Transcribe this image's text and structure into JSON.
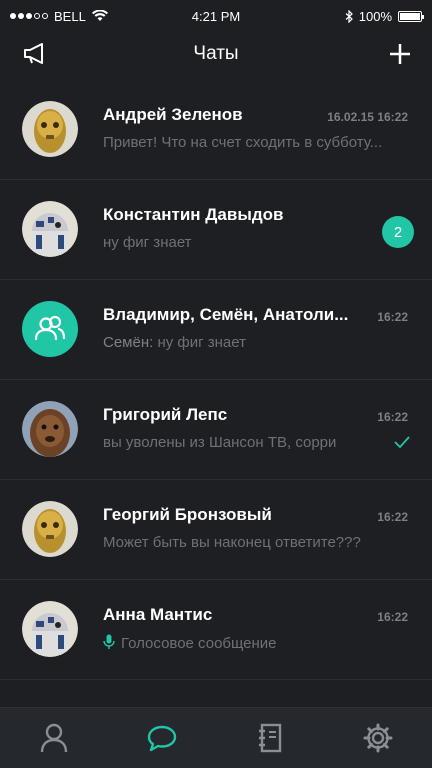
{
  "status_bar": {
    "carrier": "BELL",
    "time": "4:21 PM",
    "battery": "100%",
    "battery_level": 1.0,
    "signal_bars_filled": 3,
    "signal_bars_total": 5
  },
  "navbar": {
    "title": "Чаты",
    "left_icon": "megaphone-icon",
    "right_icon": "plus-icon"
  },
  "colors": {
    "accent": "#20c6a6",
    "background": "#1d1f23",
    "tabbar": "#25282d"
  },
  "chats": [
    {
      "name": "Андрей Зеленов",
      "time": "16.02.15 16:22",
      "preview": "Привет! Что на счет сходить в субботу...",
      "avatar": "gold-robot-avatar"
    },
    {
      "name": "Константин Давыдов",
      "time": "",
      "preview": "ну фиг знает",
      "badge": "2",
      "avatar": "astromech-robot-avatar"
    },
    {
      "name": "Владимир, Семён, Анатоли...",
      "time": "16:22",
      "sender": "Семён:",
      "preview": "ну фиг знает",
      "avatar": "group-icon"
    },
    {
      "name": "Григорий Лепс",
      "time": "16:22",
      "preview": "вы уволены из Шансон ТВ, сорри",
      "status": "read-check-icon",
      "avatar": "furry-avatar"
    },
    {
      "name": "Георгий Бронзовый",
      "time": "16:22",
      "preview": "Может быть вы наконец ответите???",
      "avatar": "gold-robot-avatar"
    },
    {
      "name": "Анна Мантис",
      "time": "16:22",
      "preview": "Голосовое сообщение",
      "avatar": "astromech-robot-avatar"
    }
  ],
  "tabs": [
    {
      "name": "contacts",
      "icon": "person-icon",
      "active": false
    },
    {
      "name": "chats",
      "icon": "chat-bubble-icon",
      "active": true
    },
    {
      "name": "address-book",
      "icon": "notebook-icon",
      "active": false
    },
    {
      "name": "settings",
      "icon": "gear-icon",
      "active": false
    }
  ]
}
